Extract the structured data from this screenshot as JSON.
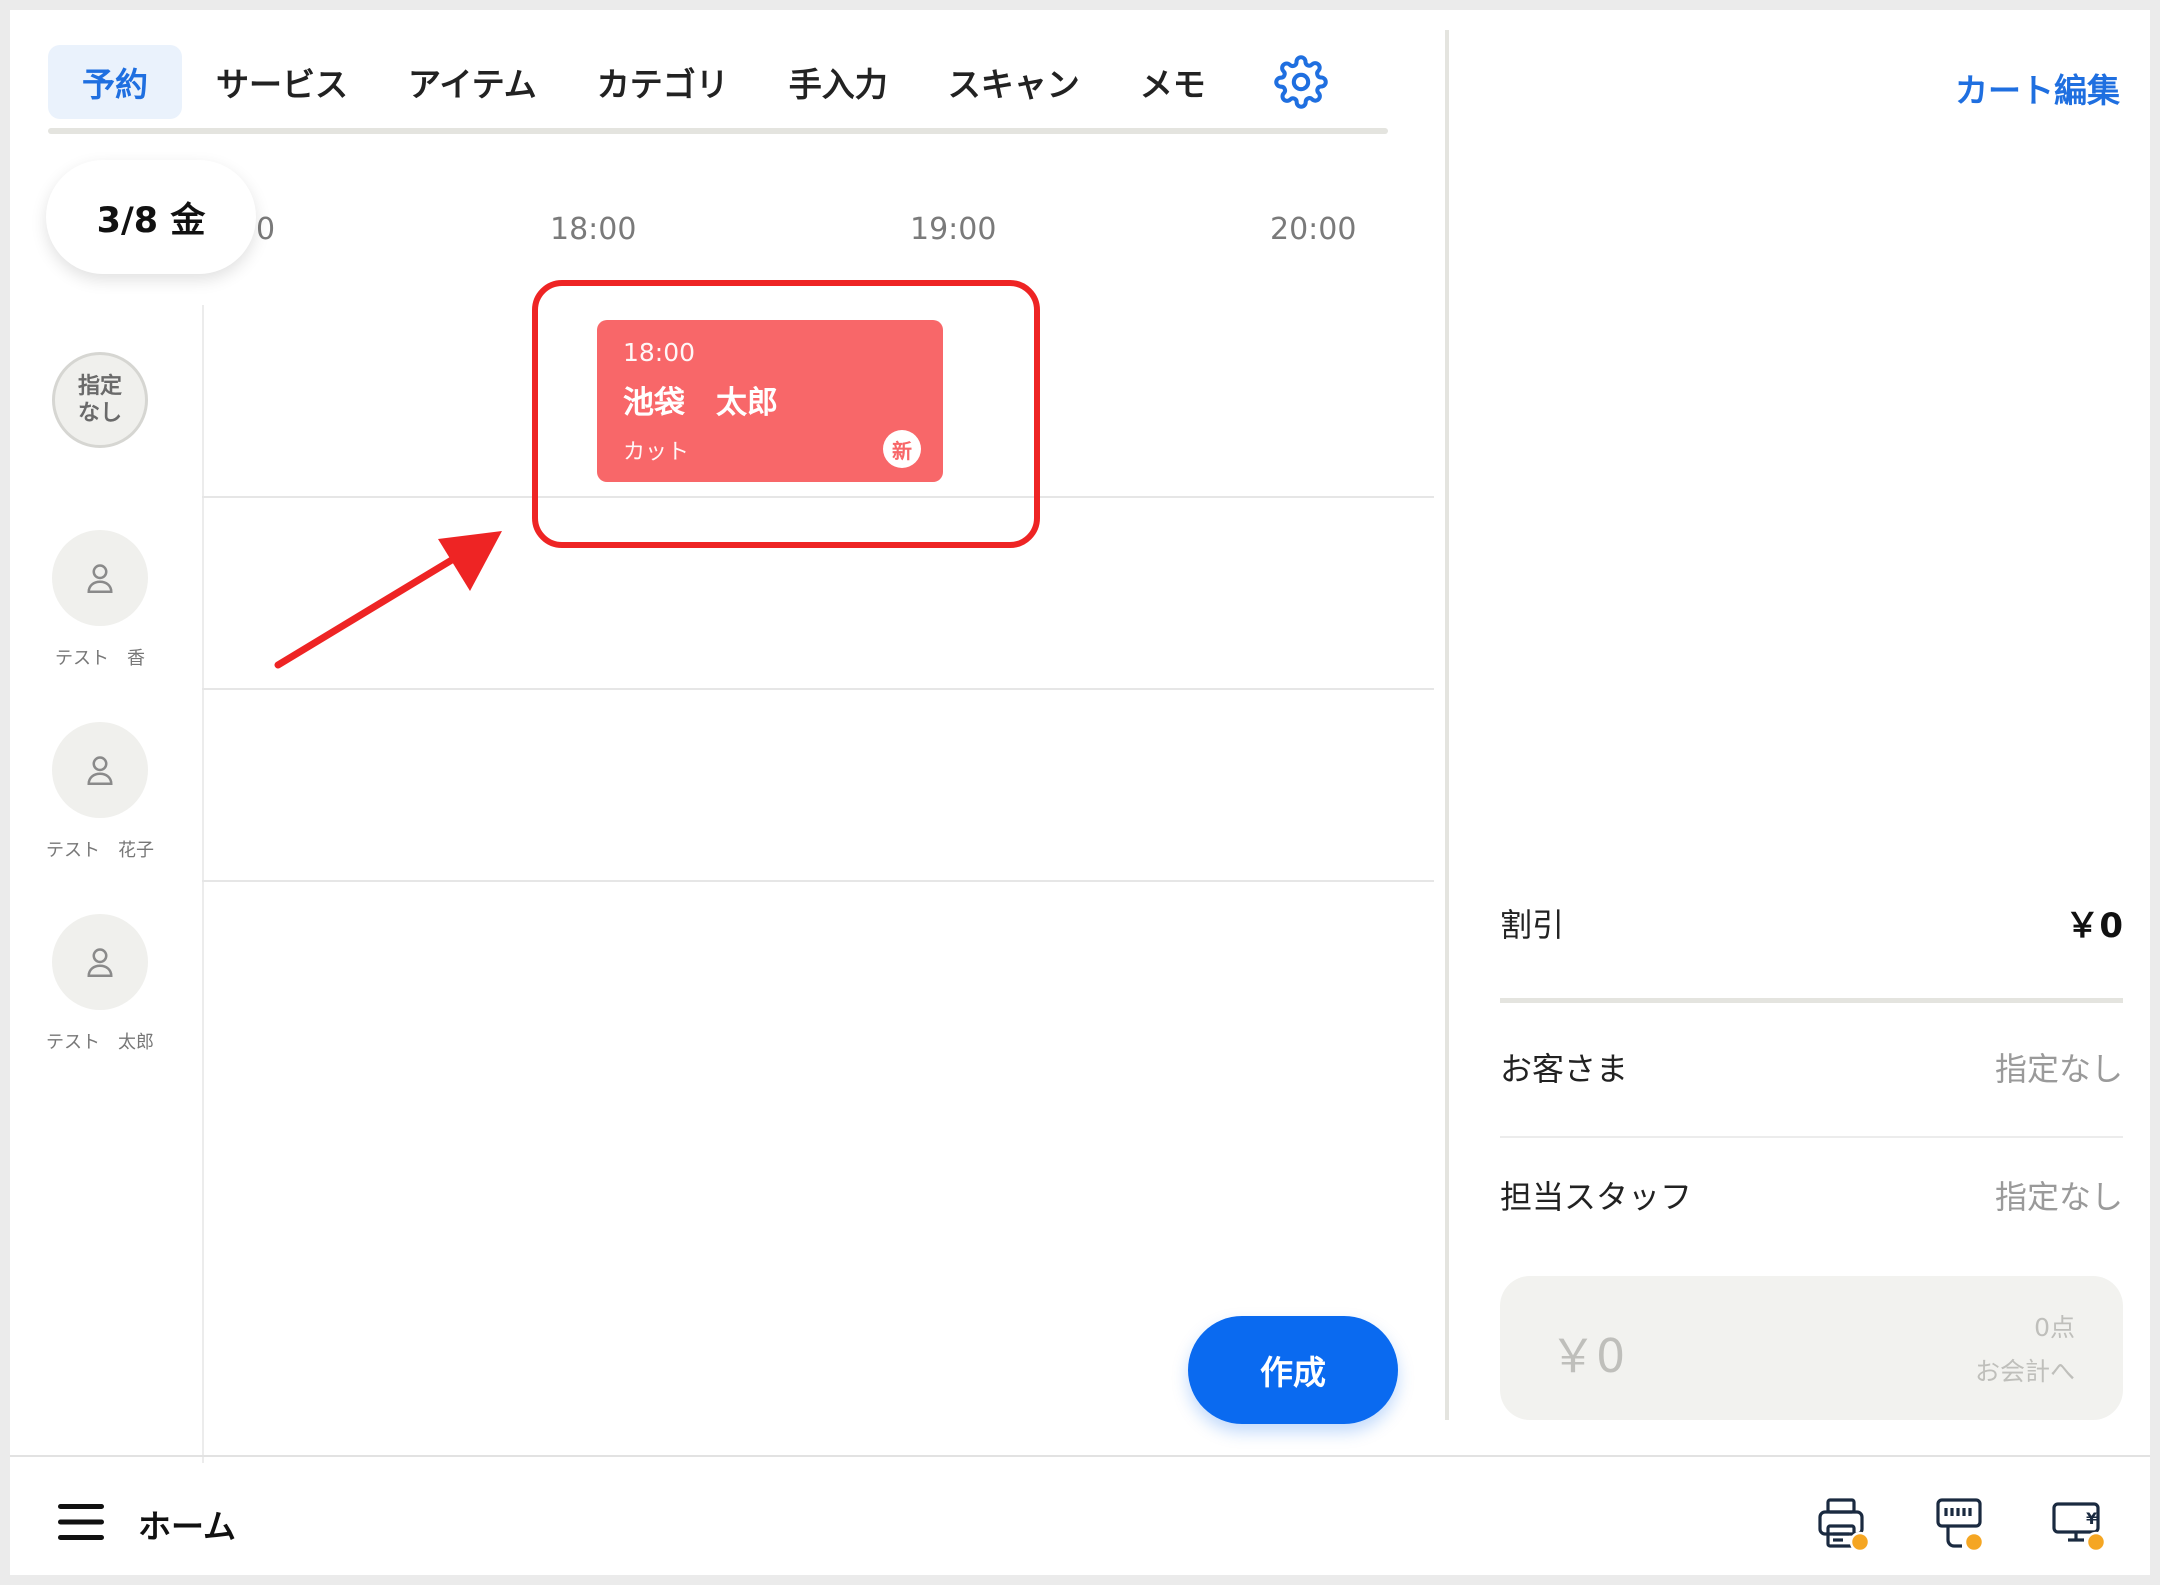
{
  "tabs": [
    {
      "label": "予約",
      "active": true
    },
    {
      "label": "サービス"
    },
    {
      "label": "アイテム"
    },
    {
      "label": "カテゴリ"
    },
    {
      "label": "手入力"
    },
    {
      "label": "スキャン"
    },
    {
      "label": "メモ"
    }
  ],
  "settings_icon": "gear-icon",
  "date_label": "3/8 金",
  "timeline": {
    "partial_hour": "0",
    "hours": [
      "18:00",
      "19:00",
      "20:00"
    ]
  },
  "staff": [
    {
      "avatar_text_1": "指定",
      "avatar_text_2": "なし"
    },
    {
      "name": "テスト　香",
      "icon": "user-icon"
    },
    {
      "name": "テスト　花子",
      "icon": "user-icon"
    },
    {
      "name": "テスト　太郎",
      "icon": "user-icon"
    }
  ],
  "booking": {
    "time": "18:00",
    "customer": "池袋　太郎",
    "service": "カット",
    "badge": "新",
    "color": "#f86769"
  },
  "create_button": "作成",
  "cart": {
    "edit_label": "カート編集",
    "discount_label": "割引",
    "discount_value": "￥0",
    "customer_label": "お客さま",
    "customer_value": "指定なし",
    "staff_label": "担当スタッフ",
    "staff_value": "指定なし",
    "total": "￥0",
    "count": "0点",
    "checkout_label": "お会計へ"
  },
  "bottom": {
    "menu_icon": "hamburger-menu-icon",
    "home_label": "ホーム",
    "device_icons": [
      "receipt-printer-icon",
      "card-reader-icon",
      "customer-display-icon"
    ],
    "status_dot_color": "#f5a623"
  },
  "colors": {
    "accent": "#1f6fe0",
    "primary_button": "#0a6af0",
    "annotation": "#ee2424"
  }
}
